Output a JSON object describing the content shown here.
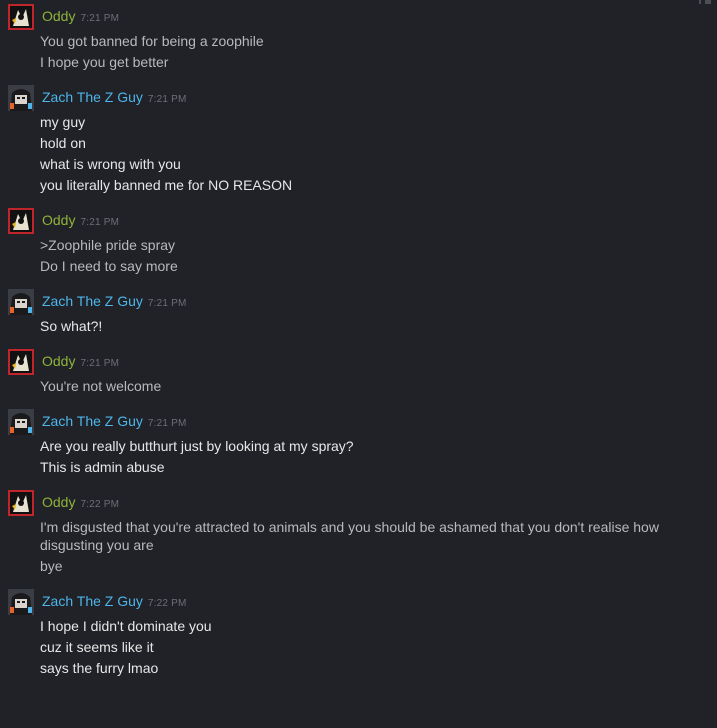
{
  "users": {
    "oddy": {
      "name": "Oddy",
      "color": "#8fb339",
      "avatar": "oddy-avatar"
    },
    "zach": {
      "name": "Zach The Z Guy",
      "color": "#4db5ea",
      "avatar": "zach-avatar"
    }
  },
  "messages": [
    {
      "user": "Oddy",
      "time": "7:21 PM",
      "lines": [
        "You got banned for being a zoophile",
        "I hope you get better"
      ]
    },
    {
      "user": "Zach The Z Guy",
      "time": "7:21 PM",
      "lines": [
        "my guy",
        "hold on",
        "what is wrong with you",
        "you literally banned me for NO REASON"
      ]
    },
    {
      "user": "Oddy",
      "time": "7:21 PM",
      "lines": [
        ">Zoophile pride spray",
        "Do I need to say more"
      ]
    },
    {
      "user": "Zach The Z Guy",
      "time": "7:21 PM",
      "lines": [
        "So what?!"
      ]
    },
    {
      "user": "Oddy",
      "time": "7:21 PM",
      "lines": [
        "You're not welcome"
      ]
    },
    {
      "user": "Zach The Z Guy",
      "time": "7:21 PM",
      "lines": [
        "Are you really butthurt just by looking at my spray?",
        "This is admin abuse"
      ]
    },
    {
      "user": "Oddy",
      "time": "7:22 PM",
      "lines": [
        "I'm disgusted that you're attracted to animals and you should be ashamed that you don't realise how disgusting you are",
        "bye"
      ]
    },
    {
      "user": "Zach The Z Guy",
      "time": "7:22 PM",
      "lines": [
        "I hope I didn't dominate you",
        "cuz it seems like it",
        "says the furry lmao"
      ]
    }
  ],
  "corner_icon": "settings-dropdown-icon"
}
